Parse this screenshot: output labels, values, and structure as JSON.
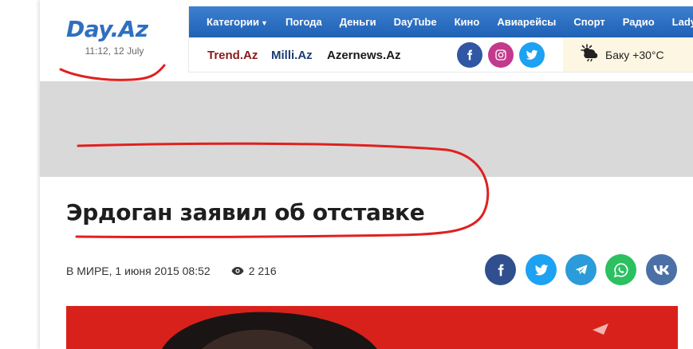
{
  "header": {
    "logo": "Day.Az",
    "time": "11:12, 12 July",
    "nav": [
      {
        "label": "Категории",
        "has_caret": true
      },
      {
        "label": "Погода"
      },
      {
        "label": "Деньги"
      },
      {
        "label": "DayTube"
      },
      {
        "label": "Кино"
      },
      {
        "label": "Авиарейсы"
      },
      {
        "label": "Спорт"
      },
      {
        "label": "Радио"
      },
      {
        "label": "Lady.Day"
      }
    ],
    "partners": [
      "Trend.Az",
      "Milli.Az",
      "Azernews.Az"
    ],
    "social_icons": [
      "facebook-icon",
      "instagram-icon",
      "twitter-icon"
    ],
    "weather": {
      "icon": "sun-cloud-icon",
      "text": "Баку +30°C"
    }
  },
  "article": {
    "title": "Эрдоган заявил об отставке",
    "category_date": "В МИРЕ, 1 июня 2015 08:52",
    "views": "2 216",
    "share_icons": [
      "facebook-icon",
      "twitter-icon",
      "telegram-icon",
      "whatsapp-icon",
      "vk-icon"
    ]
  },
  "colors": {
    "nav_blue": "#1f62b5",
    "logo_blue": "#2f6fc0",
    "banner_gray": "#d9d9d9",
    "annotation_red": "#e02020",
    "photo_red": "#d9211c"
  }
}
